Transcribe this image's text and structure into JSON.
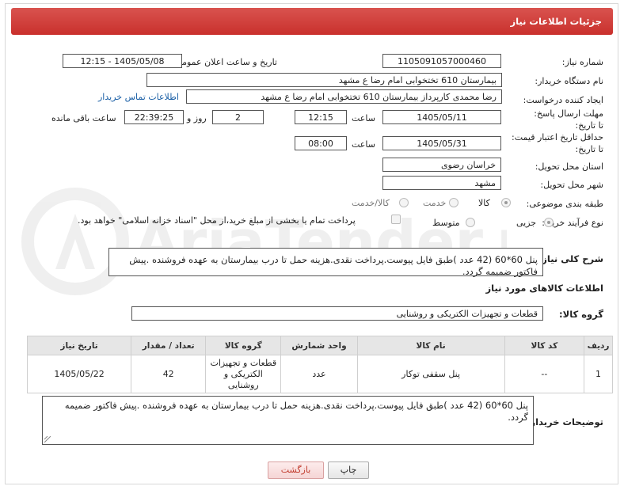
{
  "header": {
    "title": "جزئیات اطلاعات نیاز"
  },
  "need_number": {
    "label": "شماره نیاز:",
    "value": "1105091057000460"
  },
  "announce_datetime": {
    "label": "تاریخ و ساعت اعلان عمومی:",
    "value": "1405/05/08 - 12:15"
  },
  "buyer_org": {
    "label": "نام دستگاه خریدار:",
    "value": "بیمارستان 610 تختخوابی امام رضا ع  مشهد"
  },
  "requester": {
    "label": "ایجاد کننده درخواست:",
    "value": "رضا محمدی کارپرداز بیمارستان 610 تختخوابی امام رضا ع  مشهد",
    "contact_link": "اطلاعات تماس خریدار"
  },
  "reply_deadline": {
    "label": "مهلت ارسال پاسخ: تا تاریخ:",
    "date": "1405/05/11",
    "time_label": "ساعت",
    "time": "12:15",
    "days": "2",
    "days_label": "روز و",
    "remaining": "22:39:25",
    "remaining_label": "ساعت باقی مانده"
  },
  "price_validity": {
    "label": "حداقل تاریخ اعتبار قیمت: تا تاریخ:",
    "date": "1405/05/31",
    "time_label": "ساعت",
    "time": "08:00"
  },
  "delivery_province": {
    "label": "استان محل تحویل:",
    "value": "خراسان رضوی"
  },
  "delivery_city": {
    "label": "شهر محل تحویل:",
    "value": "مشهد"
  },
  "category": {
    "label": "طبقه بندی موضوعی:",
    "options": [
      "کالا",
      "خدمت",
      "کالا/خدمت"
    ],
    "selected": "کالا"
  },
  "purchase_type": {
    "label": "نوع فرآیند خرید :",
    "options": [
      "جزیی",
      "متوسط"
    ],
    "selected": "جزیی",
    "payment_note": "پرداخت تمام یا بخشی از مبلغ خرید،از محل \"اسناد خزانه اسلامی\" خواهد بود."
  },
  "overall_description": {
    "label": "شرح کلی نیاز:",
    "value": "پنل 60*60 (42 عدد )طبق فایل پیوست.پرداخت نقدی.هزینه حمل تا درب بیمارستان به عهده فروشنده .پیش فاکتور ضمیمه گردد."
  },
  "goods_info": {
    "title": "اطلاعات کالاهای مورد نیاز"
  },
  "goods_group": {
    "label": "گروه کالا:",
    "value": "قطعات و تجهیزات الکتریکی و روشنایی"
  },
  "table": {
    "headers": [
      "ردیف",
      "کد کالا",
      "نام کالا",
      "واحد شمارش",
      "گروه کالا",
      "تعداد / مقدار",
      "تاریخ نیاز"
    ],
    "rows": [
      {
        "row": "1",
        "code": "--",
        "name": "پنل سقفی توکار",
        "unit": "عدد",
        "group": "قطعات و تجهیزات الکتریکی و روشنایی",
        "qty": "42",
        "date": "1405/05/22"
      }
    ]
  },
  "buyer_notes": {
    "label": "توضیحات خریدار:",
    "value": "پنل 60*60 (42 عدد )طبق فایل پیوست.پرداخت نقدی.هزینه حمل تا درب بیمارستان به عهده فروشنده .پیش فاکتور ضمیمه گردد."
  },
  "buttons": {
    "print": "چاپ",
    "back": "بازگشت"
  },
  "watermark": {
    "text": "AriaTender.net"
  },
  "colors": {
    "header_red": "#d9534f",
    "link_blue": "#1a5fa6"
  }
}
